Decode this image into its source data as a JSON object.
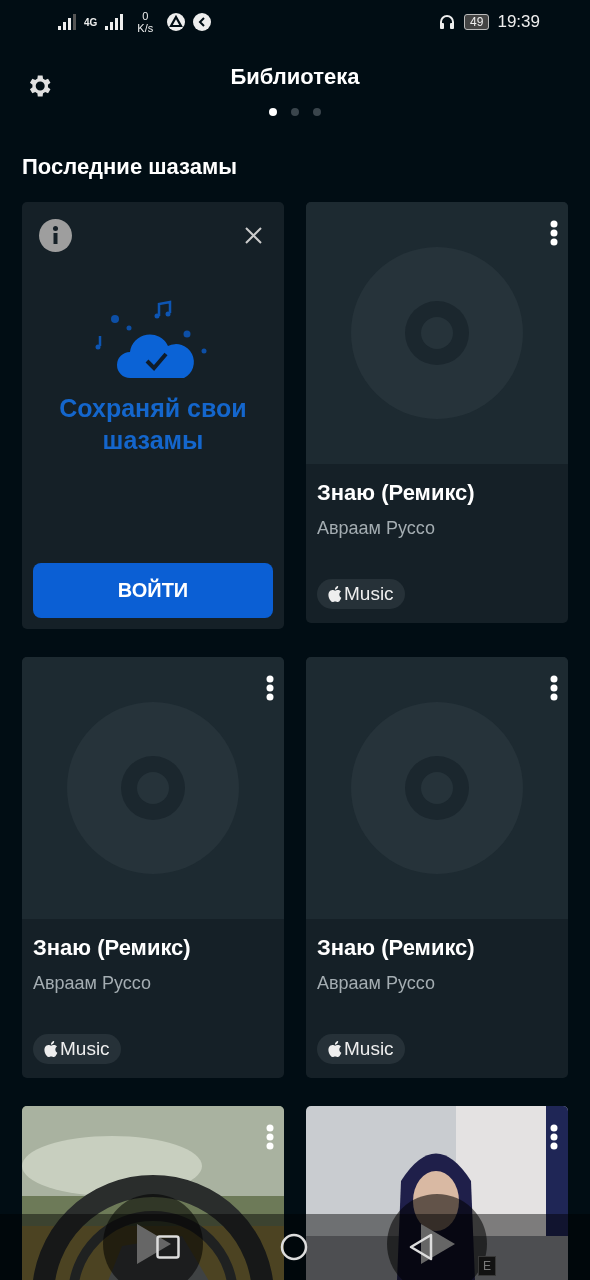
{
  "status_bar": {
    "network": "4G",
    "speed_value": "0",
    "speed_unit": "K/s",
    "battery": "49",
    "time": "19:39"
  },
  "header": {
    "title": "Библиотека",
    "pages": [
      {
        "selected": true
      },
      {
        "selected": false
      },
      {
        "selected": false
      }
    ]
  },
  "section_title": "Последние шазамы",
  "cards": [
    {
      "kind": "promo",
      "title": "Сохраняй свои шазамы",
      "button": "ВОЙТИ"
    },
    {
      "kind": "track",
      "title": "Знаю (Ремикс)",
      "artist": "Авраам Руссо",
      "badge": "Music"
    },
    {
      "kind": "track",
      "title": "Знаю (Ремикс)",
      "artist": "Авраам Руссо",
      "badge": "Music"
    },
    {
      "kind": "track",
      "title": "Знаю (Ремикс)",
      "artist": "Авраам Руссо",
      "badge": "Music"
    },
    {
      "kind": "artwork"
    },
    {
      "kind": "artwork",
      "explicit": "E"
    }
  ]
}
